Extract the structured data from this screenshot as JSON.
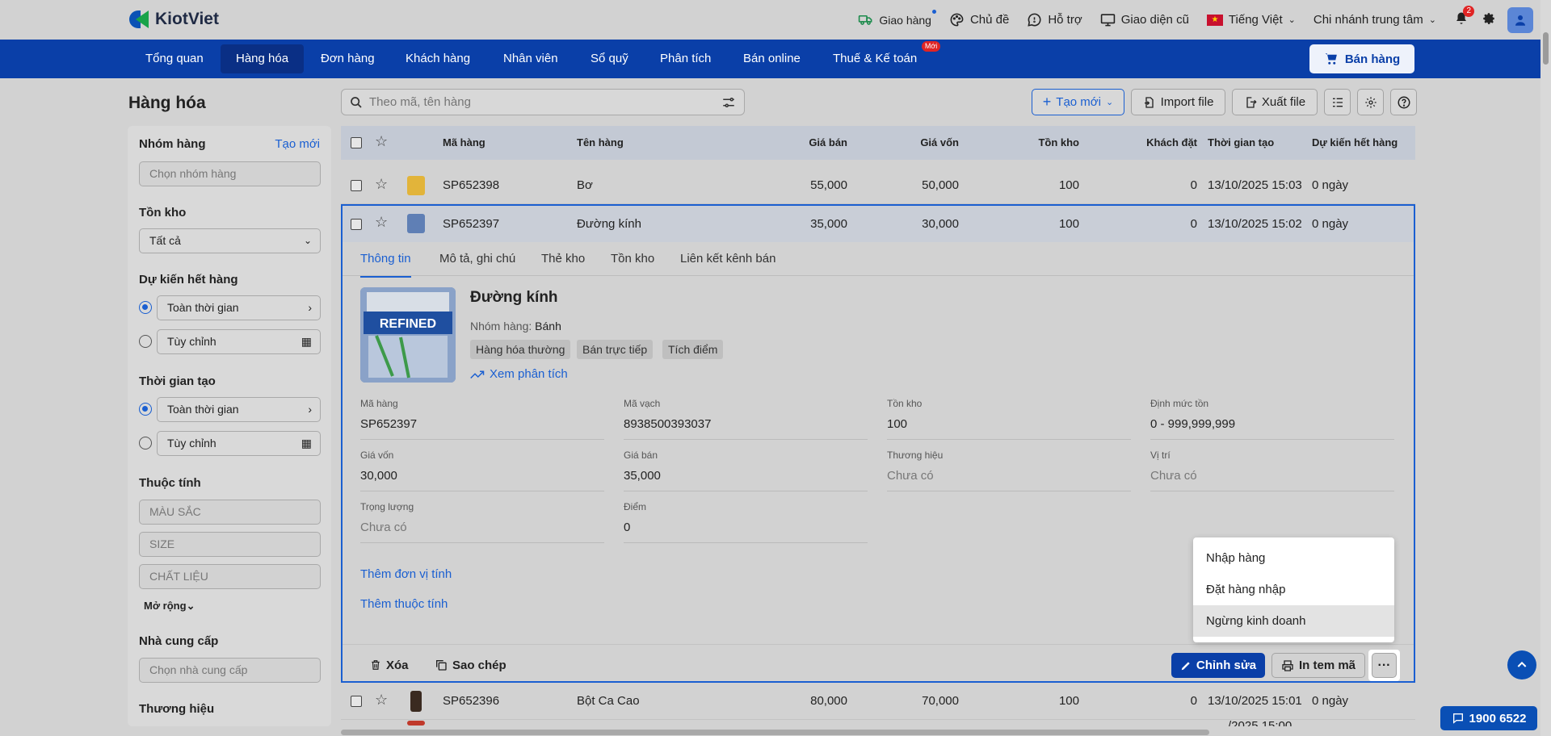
{
  "brand": {
    "name": "KiotViet"
  },
  "topbar": {
    "delivery": "Giao hàng",
    "theme": "Chủ đề",
    "support": "Hỗ trợ",
    "old_ui": "Giao diện cũ",
    "language": "Tiếng Việt",
    "branch": "Chi nhánh trung tâm",
    "notification_count": "2"
  },
  "nav": {
    "items": [
      "Tổng quan",
      "Hàng hóa",
      "Đơn hàng",
      "Khách hàng",
      "Nhân viên",
      "Sổ quỹ",
      "Phân tích",
      "Bán online",
      "Thuế & Kế toán"
    ],
    "new_badge": "Mới",
    "sell_button": "Bán hàng",
    "active": "Hàng hóa"
  },
  "page": {
    "title": "Hàng hóa"
  },
  "sidebar": {
    "group_title": "Nhóm hàng",
    "group_create": "Tạo mới",
    "group_placeholder": "Chọn nhóm hàng",
    "stock_title": "Tồn kho",
    "stock_value": "Tất cả",
    "expiry_title": "Dự kiến hết hàng",
    "expiry_all": "Toàn thời gian",
    "expiry_custom": "Tùy chỉnh",
    "created_title": "Thời gian tạo",
    "created_all": "Toàn thời gian",
    "created_custom": "Tùy chỉnh",
    "attr_title": "Thuộc tính",
    "attr_color": "MÀU SẮC",
    "attr_size": "SIZE",
    "attr_material": "CHẤT LIỆU",
    "expand": "Mở rộng",
    "supplier_title": "Nhà cung cấp",
    "supplier_placeholder": "Chọn nhà cung cấp",
    "brand_title": "Thương hiệu"
  },
  "toolbar": {
    "search_placeholder": "Theo mã, tên hàng",
    "create": "Tạo mới",
    "import": "Import file",
    "export": "Xuất file"
  },
  "table": {
    "headers": {
      "code": "Mã hàng",
      "name": "Tên hàng",
      "price": "Giá bán",
      "cost": "Giá vốn",
      "stock": "Tồn kho",
      "ordered": "Khách đặt",
      "created": "Thời gian tạo",
      "expiry": "Dự kiến hết hàng"
    },
    "rows": [
      {
        "code": "SP652398",
        "name": "Bơ",
        "price": "55,000",
        "cost": "50,000",
        "stock": "100",
        "ordered": "0",
        "created": "13/10/2025 15:03",
        "expiry": "0 ngày"
      },
      {
        "code": "SP652397",
        "name": "Đường kính",
        "price": "35,000",
        "cost": "30,000",
        "stock": "100",
        "ordered": "0",
        "created": "13/10/2025 15:02",
        "expiry": "0 ngày"
      },
      {
        "code": "SP652396",
        "name": "Bột Ca Cao",
        "price": "80,000",
        "cost": "70,000",
        "stock": "100",
        "ordered": "0",
        "created": "13/10/2025 15:01",
        "expiry": "0 ngày"
      },
      {
        "created": "/2025 15:00"
      }
    ]
  },
  "detail": {
    "tabs": [
      "Thông tin",
      "Mô tả, ghi chú",
      "Thẻ kho",
      "Tồn kho",
      "Liên kết kênh bán"
    ],
    "name": "Đường kính",
    "group_label": "Nhóm hàng:",
    "group_value": "Bánh",
    "tags": [
      "Hàng hóa thường",
      "Bán trực tiếp",
      "Tích điểm"
    ],
    "analysis_link": "Xem phân tích",
    "image_text": "REFINED",
    "fields": [
      {
        "label": "Mã hàng",
        "value": "SP652397"
      },
      {
        "label": "Mã vạch",
        "value": "8938500393037"
      },
      {
        "label": "Tồn kho",
        "value": "100"
      },
      {
        "label": "Định mức tồn",
        "value": "0 - 999,999,999"
      },
      {
        "label": "Giá vốn",
        "value": "30,000"
      },
      {
        "label": "Giá bán",
        "value": "35,000"
      },
      {
        "label": "Thương hiệu",
        "value": "Chưa có"
      },
      {
        "label": "Vị trí",
        "value": "Chưa có"
      },
      {
        "label": "Trọng lượng",
        "value": "Chưa có"
      },
      {
        "label": "Điểm",
        "value": "0"
      }
    ],
    "add_unit": "Thêm đơn vị tính",
    "add_attr": "Thêm thuộc tính",
    "delete": "Xóa",
    "copy": "Sao chép",
    "edit": "Chỉnh sửa",
    "print": "In tem mã",
    "more": "···"
  },
  "dropdown": {
    "items": [
      "Nhập hàng",
      "Đặt hàng nhập",
      "Ngừng kinh doanh"
    ]
  },
  "hotline": "1900 6522",
  "colors": {
    "primary": "#0a3fa8",
    "link": "#1a5fd1",
    "badge": "#e02424"
  }
}
